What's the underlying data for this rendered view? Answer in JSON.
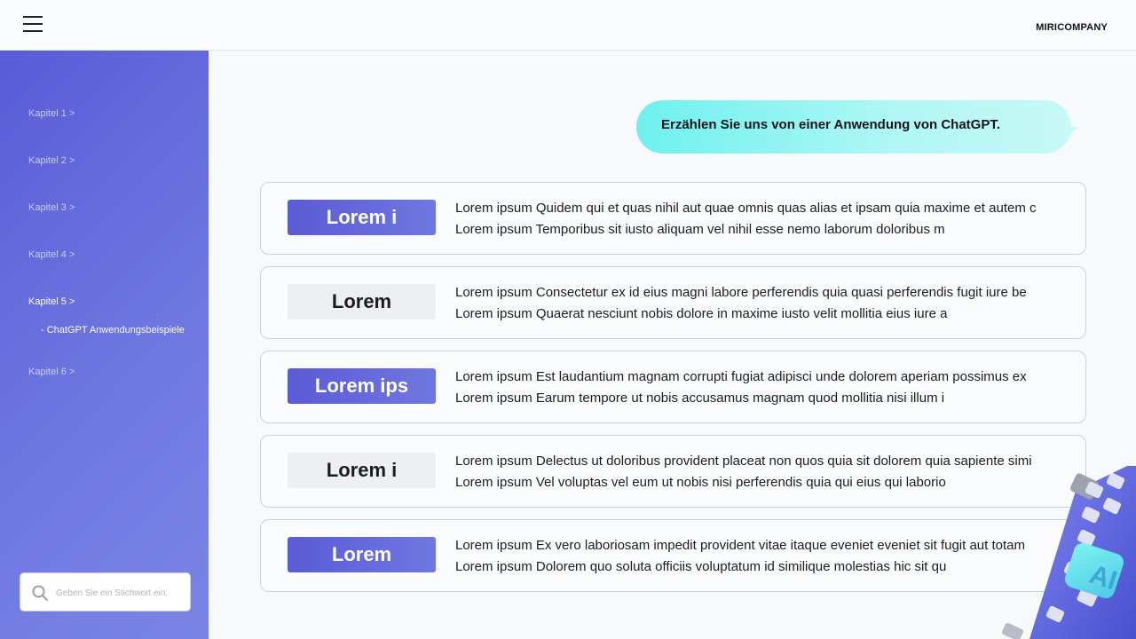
{
  "header": {
    "menu_icon": "hamburger-icon",
    "brand": "MIRICOMPANY"
  },
  "sidebar": {
    "items": [
      {
        "label": "Kapitel 1 >"
      },
      {
        "label": "Kapitel 2 >"
      },
      {
        "label": "Kapitel 3 >"
      },
      {
        "label": "Kapitel 4 >"
      },
      {
        "label": "Kapitel 5 >"
      },
      {
        "label": "Kapitel 6 >"
      }
    ],
    "subitem": "- ChatGPT Anwendungsbeispiele",
    "search": {
      "icon": "search-icon",
      "placeholder": "Geben Sie ein Stichwort ein."
    }
  },
  "main": {
    "question": "Erzählen Sie uns von einer Anwendung von ChatGPT.",
    "rows": [
      {
        "tag": "Lorem i",
        "tag_style": "purple",
        "line1": "Lorem ipsum Quidem qui et quas nihil aut quae omnis quas alias et ipsam quia maxime et autem c",
        "line2": "Lorem ipsum Temporibus sit iusto aliquam vel nihil esse nemo laborum doloribus m"
      },
      {
        "tag": "Lorem",
        "tag_style": "grey",
        "line1": "Lorem ipsum Consectetur ex id eius magni labore perferendis quia quasi perferendis fugit iure be",
        "line2": "Lorem ipsum Quaerat nesciunt nobis dolore in maxime iusto velit mollitia eius iure a"
      },
      {
        "tag": "Lorem ips",
        "tag_style": "purple",
        "line1": "Lorem ipsum Est laudantium magnam corrupti fugiat adipisci unde dolorem aperiam possimus ex",
        "line2": "Lorem ipsum Earum tempore ut nobis accusamus magnam quod mollitia nisi illum i"
      },
      {
        "tag": "Lorem i",
        "tag_style": "grey",
        "line1": "Lorem ipsum Delectus ut doloribus provident placeat non quos quia sit dolorem quia sapiente simi",
        "line2": "Lorem ipsum Vel voluptas vel eum ut nobis nisi perferendis quia qui eius qui laborio"
      },
      {
        "tag": "Lorem",
        "tag_style": "purple",
        "line1": "Lorem ipsum Ex vero laboriosam impedit provident vitae itaque eveniet eveniet sit fugit aut totam",
        "line2": "Lorem ipsum Dolorem quo soluta officiis voluptatum id similique molestias hic sit qu"
      }
    ]
  },
  "decoration": {
    "icon": "ai-keyboard-illustration",
    "key_label": "AI"
  },
  "colors": {
    "accent_purple": "#5b5bd6",
    "bubble_cyan": "#6ef1ef",
    "tag_grey": "#eeeff1"
  }
}
